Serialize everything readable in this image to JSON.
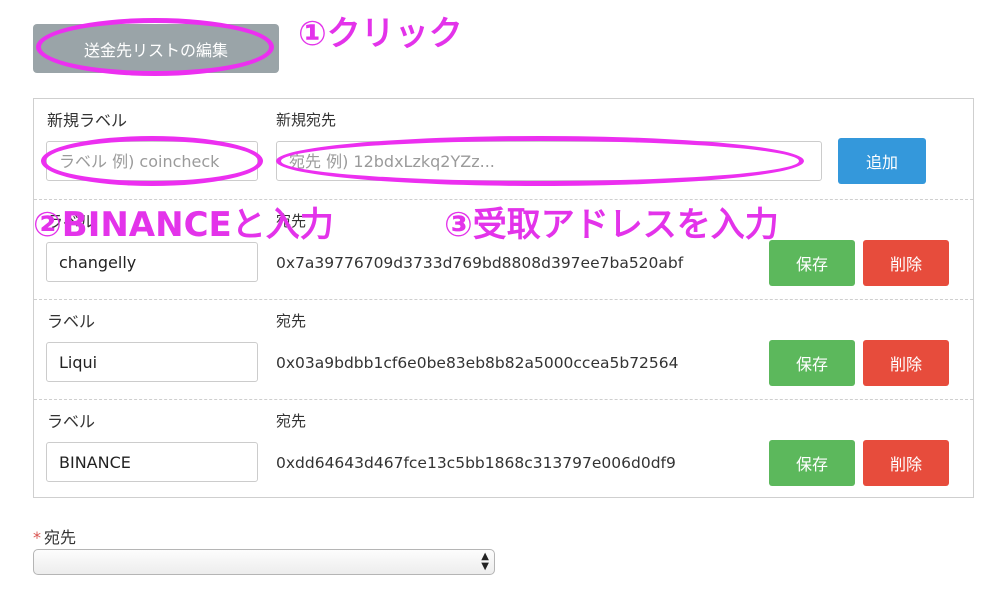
{
  "edit_list_button": "送金先リストの編集",
  "new_entry": {
    "label_heading": "新規ラベル",
    "address_heading": "新規宛先",
    "label_placeholder": "ラベル 例) coincheck",
    "address_placeholder": "宛先 例) 12bdxLzkq2YZz...",
    "add_button": "追加"
  },
  "entries": [
    {
      "label_heading": "ラベル",
      "address_heading": "宛先",
      "label_value": "changelly",
      "address": "0x7a39776709d3733d769bd8808d397ee7ba520abf",
      "save": "保存",
      "delete": "削除"
    },
    {
      "label_heading": "ラベル",
      "address_heading": "宛先",
      "label_value": "Liqui",
      "address": "0x03a9bdbb1cf6e0be83eb8b82a5000ccea5b72564",
      "save": "保存",
      "delete": "削除"
    },
    {
      "label_heading": "ラベル",
      "address_heading": "宛先",
      "label_value": "BINANCE",
      "address": "0xdd64643d467fce13c5bb1868c313797e006d0df9",
      "save": "保存",
      "delete": "削除"
    }
  ],
  "destination": {
    "required_mark": "*",
    "label": "宛先",
    "selected": ""
  },
  "annotations": {
    "step1": "①クリック",
    "step2": "②BINANCEと入力",
    "step3": "③受取アドレスを入力",
    "color": "#ec2ff0"
  },
  "colors": {
    "add_button": "#3498db",
    "save_button": "#5cb85c",
    "delete_button": "#e74c3c",
    "edit_button": "#9aa4a8"
  }
}
